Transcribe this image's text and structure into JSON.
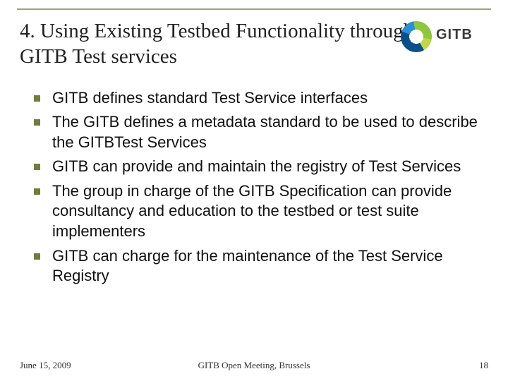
{
  "title": "4. Using Existing Testbed Functionality through GITB Test services",
  "logo": {
    "text": "GITB"
  },
  "bullets": [
    "GITB defines standard Test Service interfaces",
    "The GITB defines a metadata standard to be used to describe the GITBTest Services",
    "GITB can provide and maintain the registry of Test Services",
    "The group in charge of the GITB Specification can provide consultancy and education to the testbed or test suite implementers",
    "GITB can charge for the maintenance of the Test Service Registry"
  ],
  "footer": {
    "date": "June 15, 2009",
    "center": "GITB Open Meeting, Brussels",
    "page": "18"
  }
}
